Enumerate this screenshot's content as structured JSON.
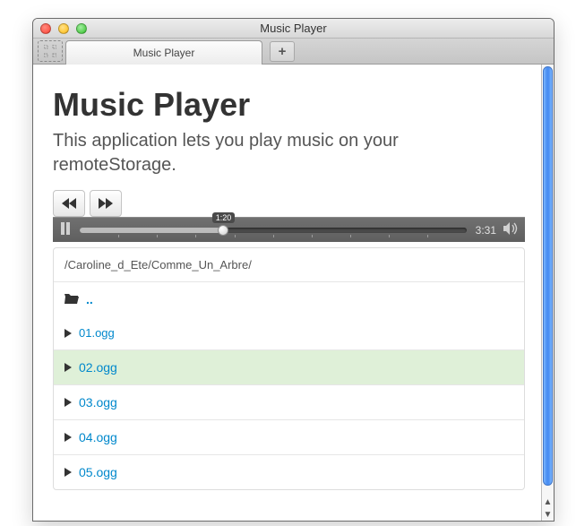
{
  "window": {
    "title": "Music Player"
  },
  "tabbar": {
    "tab_label": "Music Player",
    "newtab_label": "+"
  },
  "header": {
    "title": "Music Player",
    "lead": "This application lets you play music on your remoteStorage."
  },
  "player": {
    "position_label": "1:20",
    "duration_label": "3:31"
  },
  "breadcrumb": "/Caroline_d_Ete/Comme_Un_Arbre/",
  "parent_label": "..",
  "files": [
    {
      "name": "01.ogg",
      "active": false
    },
    {
      "name": "02.ogg",
      "active": true
    },
    {
      "name": "03.ogg",
      "active": false
    },
    {
      "name": "04.ogg",
      "active": false
    },
    {
      "name": "05.ogg",
      "active": false
    }
  ]
}
